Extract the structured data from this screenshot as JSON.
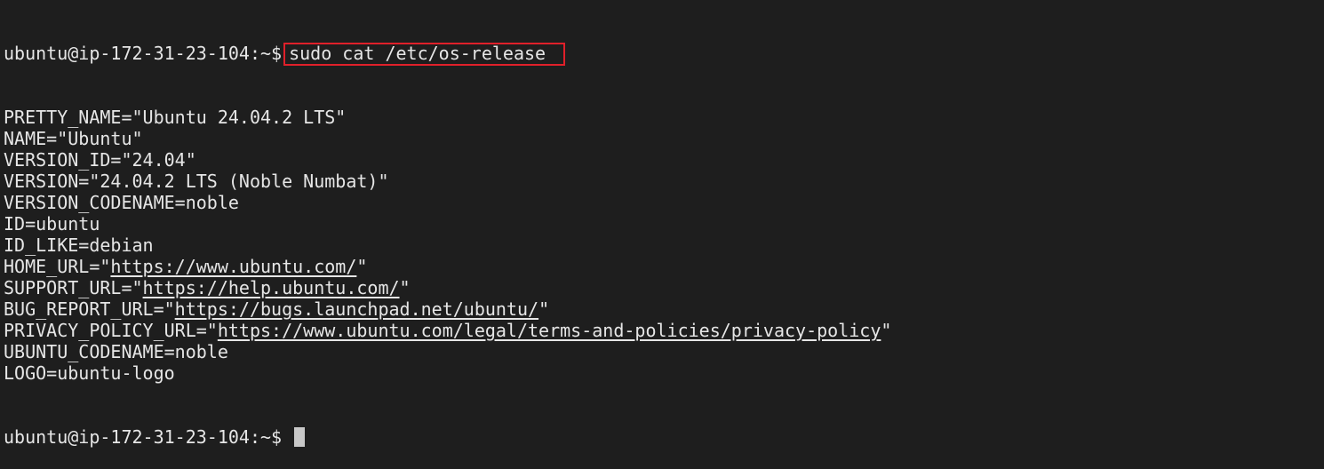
{
  "terminal": {
    "prompt": "ubuntu@ip-172-31-23-104:~$",
    "command": "sudo cat /etc/os-release",
    "highlight_color": "#e0202a",
    "output": [
      {
        "key": "PRETTY_NAME=",
        "q1": "\"",
        "value": "Ubuntu 24.04.2 LTS",
        "q2": "\""
      },
      {
        "key": "NAME=",
        "q1": "\"",
        "value": "Ubuntu",
        "q2": "\""
      },
      {
        "key": "VERSION_ID=",
        "q1": "\"",
        "value": "24.04",
        "q2": "\""
      },
      {
        "key": "VERSION=",
        "q1": "\"",
        "value": "24.04.2 LTS (Noble Numbat)",
        "q2": "\""
      },
      {
        "key": "VERSION_CODENAME=",
        "q1": "",
        "value": "noble",
        "q2": ""
      },
      {
        "key": "ID=",
        "q1": "",
        "value": "ubuntu",
        "q2": ""
      },
      {
        "key": "ID_LIKE=",
        "q1": "",
        "value": "debian",
        "q2": ""
      },
      {
        "key": "HOME_URL=",
        "q1": "\"",
        "link": "https://www.ubuntu.com/",
        "q2": "\""
      },
      {
        "key": "SUPPORT_URL=",
        "q1": "\"",
        "link": "https://help.ubuntu.com/",
        "q2": "\""
      },
      {
        "key": "BUG_REPORT_URL=",
        "q1": "\"",
        "link": "https://bugs.launchpad.net/ubuntu/",
        "q2": "\""
      },
      {
        "key": "PRIVACY_POLICY_URL=",
        "q1": "\"",
        "link": "https://www.ubuntu.com/legal/terms-and-policies/privacy-policy",
        "q2": "\""
      },
      {
        "key": "UBUNTU_CODENAME=",
        "q1": "",
        "value": "noble",
        "q2": ""
      },
      {
        "key": "LOGO=",
        "q1": "",
        "value": "ubuntu-logo",
        "q2": ""
      }
    ],
    "final_prompt": "ubuntu@ip-172-31-23-104:~$"
  }
}
